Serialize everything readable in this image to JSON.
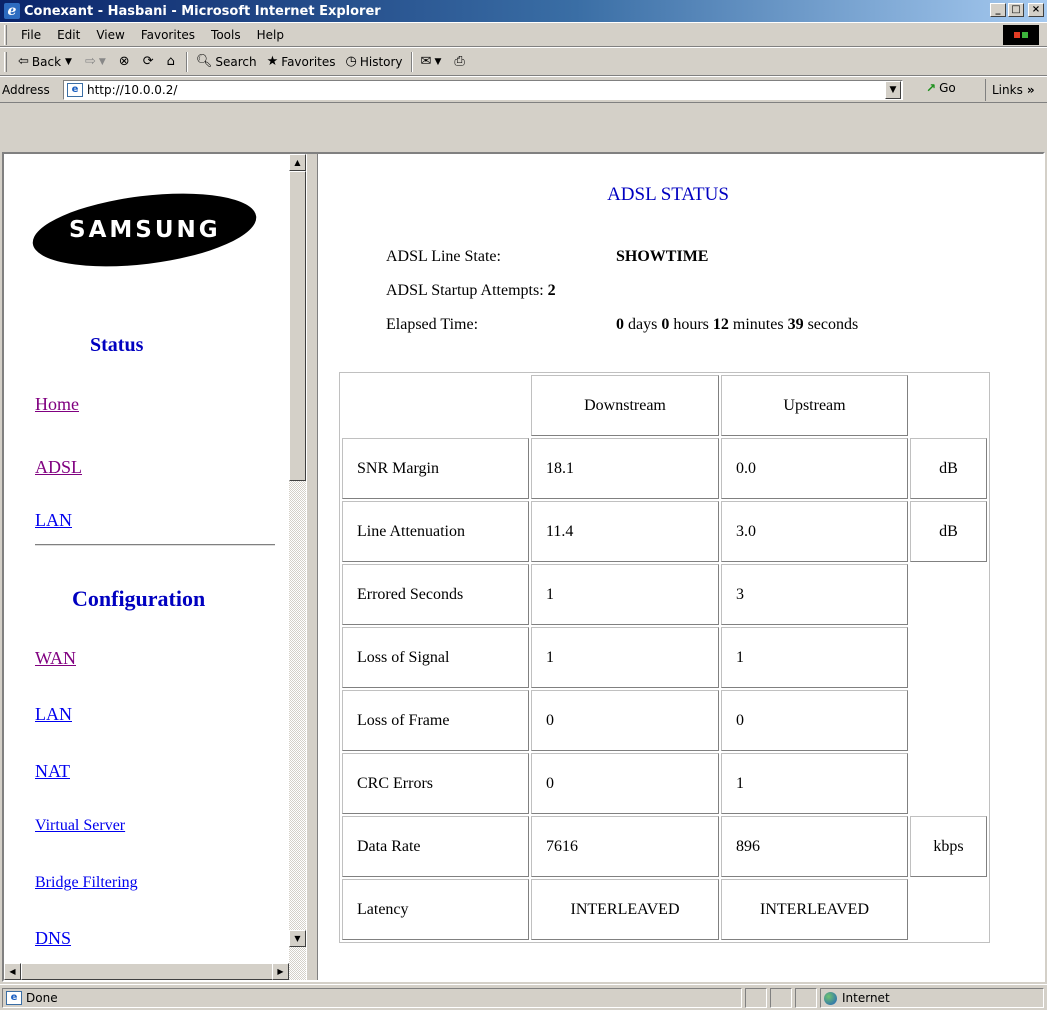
{
  "window": {
    "title": "Conexant - Hasbani - Microsoft Internet Explorer"
  },
  "menubar": {
    "items": [
      "File",
      "Edit",
      "View",
      "Favorites",
      "Tools",
      "Help"
    ]
  },
  "toolbar": {
    "back": "Back",
    "search": "Search",
    "favorites": "Favorites",
    "history": "History"
  },
  "address": {
    "label": "Address",
    "url": "http://10.0.0.2/",
    "go": "Go",
    "links": "Links"
  },
  "sidebar": {
    "logo": "SAMSUNG",
    "status_heading": "Status",
    "status_links": [
      "Home",
      "ADSL",
      "LAN"
    ],
    "config_heading": "Configuration",
    "config_links": [
      "WAN",
      "LAN",
      "NAT",
      "Virtual Server",
      "Bridge Filtering",
      "DNS"
    ]
  },
  "main": {
    "title": "ADSL STATUS",
    "line_state_label": "ADSL Line State:",
    "line_state_value": "SHOWTIME",
    "startup_label": "ADSL Startup Attempts:",
    "startup_value": "2",
    "elapsed_label": "Elapsed Time:",
    "elapsed": {
      "days": "0",
      "days_unit": "days",
      "hours": "0",
      "hours_unit": "hours",
      "minutes": "12",
      "minutes_unit": "minutes",
      "seconds": "39",
      "seconds_unit": "seconds"
    },
    "table": {
      "headers": [
        "",
        "Downstream",
        "Upstream",
        ""
      ],
      "rows": [
        [
          "SNR Margin",
          "18.1",
          "0.0",
          "dB"
        ],
        [
          "Line Attenuation",
          "11.4",
          "3.0",
          "dB"
        ],
        [
          "Errored Seconds",
          "1",
          "3",
          ""
        ],
        [
          "Loss of Signal",
          "1",
          "1",
          ""
        ],
        [
          "Loss of Frame",
          "0",
          "0",
          ""
        ],
        [
          "CRC Errors",
          "0",
          "1",
          ""
        ],
        [
          "Data Rate",
          "7616",
          "896",
          "kbps"
        ],
        [
          "Latency",
          "INTERLEAVED",
          "INTERLEAVED",
          ""
        ]
      ]
    }
  },
  "statusbar": {
    "status": "Done",
    "zone": "Internet"
  }
}
